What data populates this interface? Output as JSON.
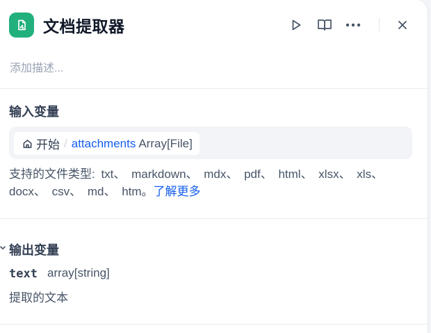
{
  "header": {
    "title": "文档提取器",
    "icon": "document-extractor-icon",
    "accent_color": "#22b07d",
    "actions": [
      "run-icon",
      "docs-book-icon",
      "more-icon",
      "close-icon"
    ]
  },
  "description_placeholder": "添加描述...",
  "input_section": {
    "title": "输入变量",
    "variable": {
      "source_icon": "home-icon",
      "source_label": "开始",
      "separator": "/",
      "name": "attachments",
      "type": "Array[File]"
    },
    "supported_text": "支持的文件类型: txt、 markdown、 mdx、 pdf、 html、 xlsx、 xls、 docx、 csv、 md、 htm。",
    "learn_more": "了解更多"
  },
  "output_section": {
    "title": "输出变量",
    "collapse_icon": "chevron-down-icon",
    "var_name": "text",
    "var_type": "array[string]",
    "var_desc": "提取的文本"
  }
}
